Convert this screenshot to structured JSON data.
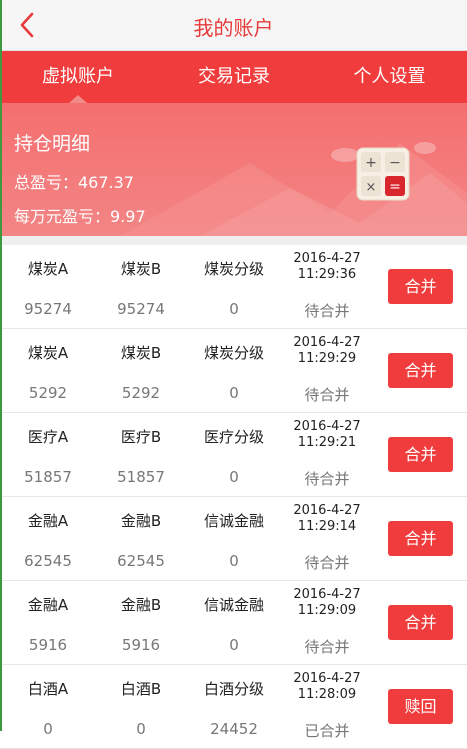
{
  "header": {
    "title": "我的账户"
  },
  "tabs": [
    {
      "label": "虚拟账户"
    },
    {
      "label": "交易记录"
    },
    {
      "label": "个人设置"
    }
  ],
  "summary": {
    "title": "持仓明细",
    "total_pnl": "总盈亏：467.37",
    "per_10k_pnl": "每万元盈亏：9.97"
  },
  "rows": [
    {
      "a": "煤炭A",
      "b": "煤炭B",
      "c": "煤炭分级",
      "date": "2016-4-27",
      "time": "11:29:36",
      "va": "95274",
      "vb": "95274",
      "vc": "0",
      "status": "待合并",
      "action": "合并"
    },
    {
      "a": "煤炭A",
      "b": "煤炭B",
      "c": "煤炭分级",
      "date": "2016-4-27",
      "time": "11:29:29",
      "va": "5292",
      "vb": "5292",
      "vc": "0",
      "status": "待合并",
      "action": "合并"
    },
    {
      "a": "医疗A",
      "b": "医疗B",
      "c": "医疗分级",
      "date": "2016-4-27",
      "time": "11:29:21",
      "va": "51857",
      "vb": "51857",
      "vc": "0",
      "status": "待合并",
      "action": "合并"
    },
    {
      "a": "金融A",
      "b": "金融B",
      "c": "信诚金融",
      "date": "2016-4-27",
      "time": "11:29:14",
      "va": "62545",
      "vb": "62545",
      "vc": "0",
      "status": "待合并",
      "action": "合并"
    },
    {
      "a": "金融A",
      "b": "金融B",
      "c": "信诚金融",
      "date": "2016-4-27",
      "time": "11:29:09",
      "va": "5916",
      "vb": "5916",
      "vc": "0",
      "status": "待合并",
      "action": "合并"
    },
    {
      "a": "白酒A",
      "b": "白酒B",
      "c": "白酒分级",
      "date": "2016-4-27",
      "time": "11:28:09",
      "va": "0",
      "vb": "0",
      "vc": "24452",
      "status": "已合并",
      "action": "赎回"
    }
  ],
  "colors": {
    "accent": "#f03c3c",
    "banner": "#f47575",
    "title": "#e83a3a"
  }
}
